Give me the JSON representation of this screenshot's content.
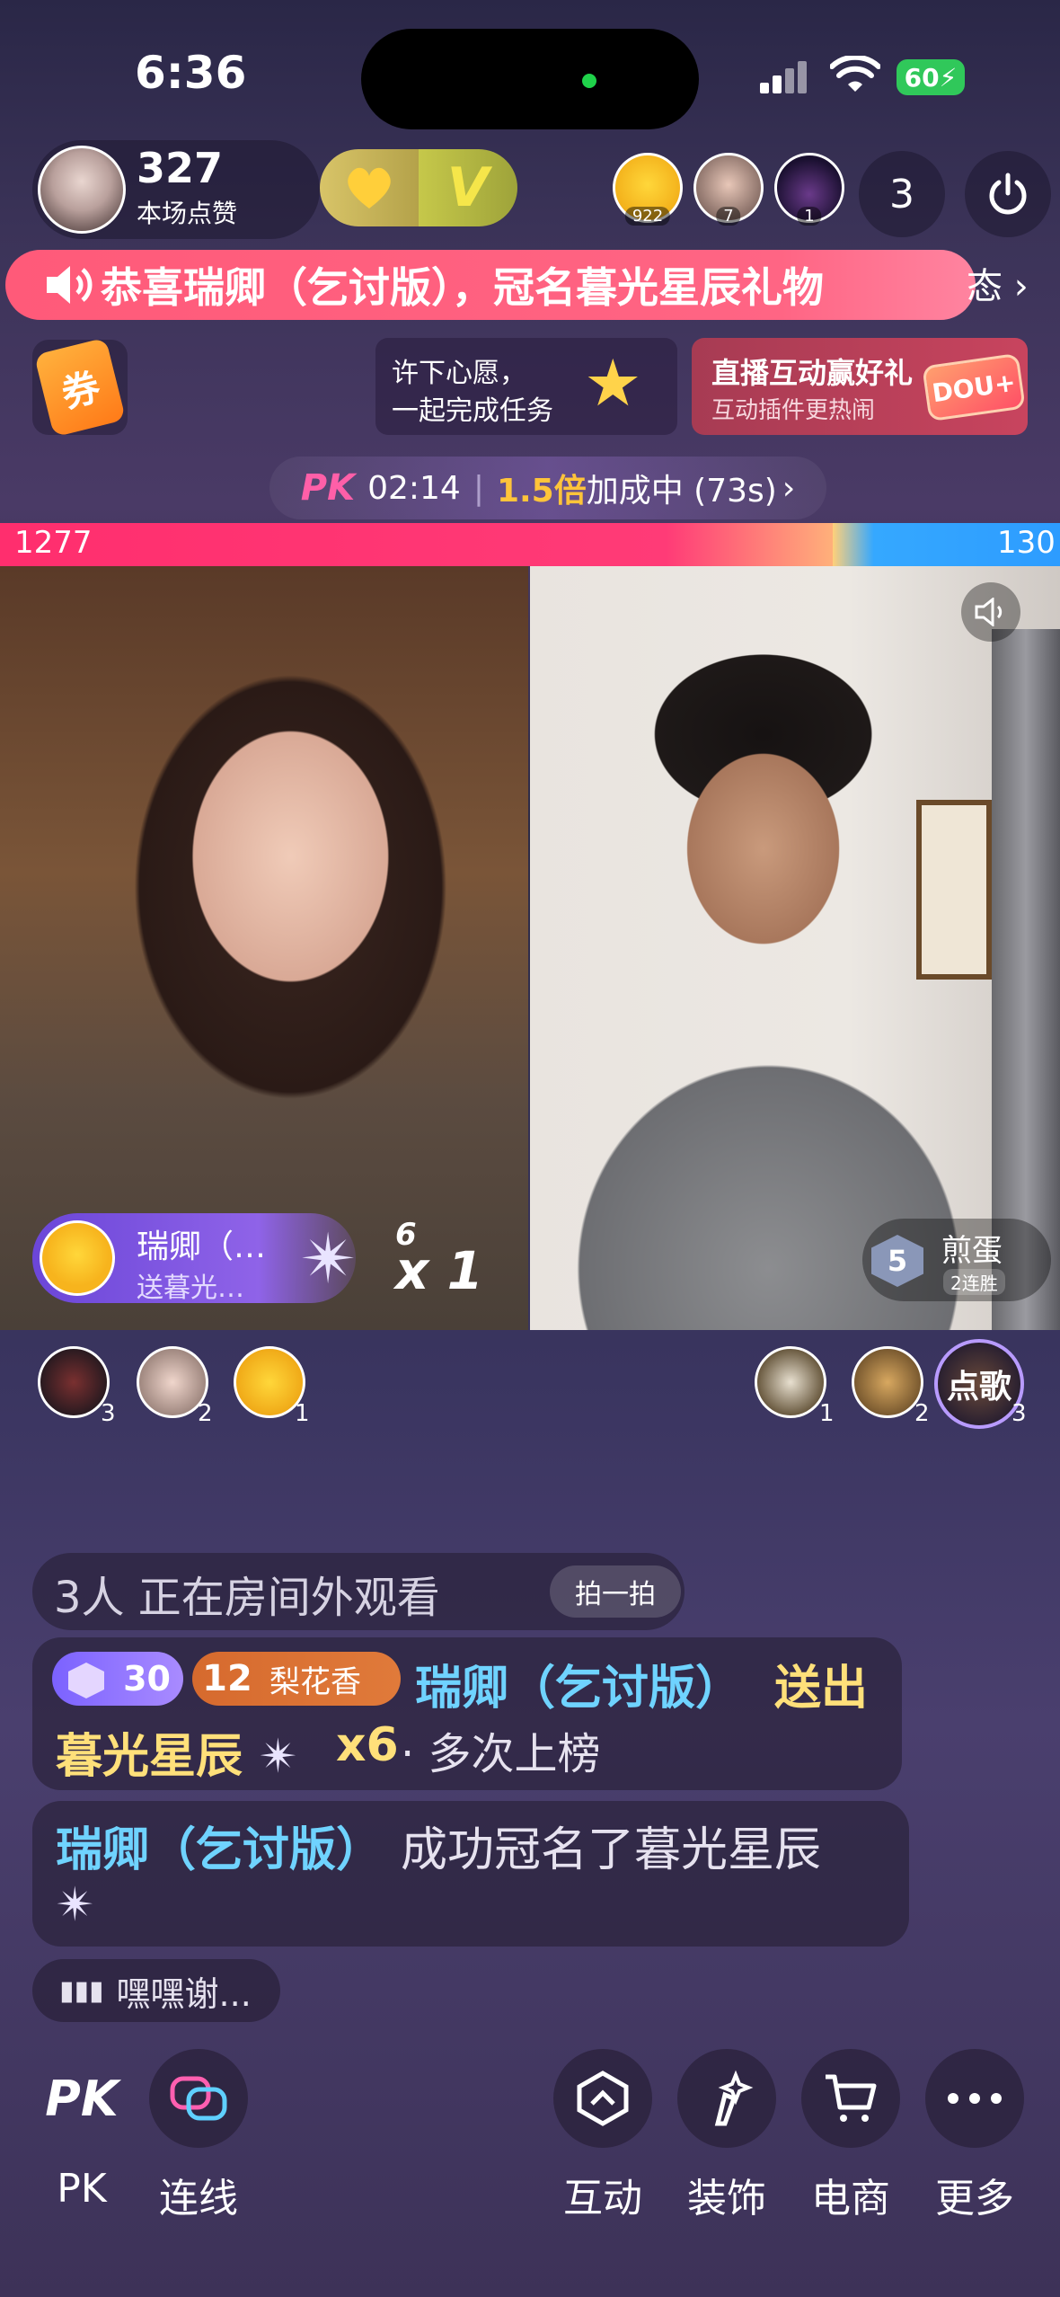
{
  "status": {
    "time": "6:36",
    "battery": "60"
  },
  "host": {
    "likes": "327",
    "likes_label": "本场点赞",
    "badge_v": "V"
  },
  "viewers": [
    {
      "num": "922"
    },
    {
      "num": "7"
    },
    {
      "num": "1"
    }
  ],
  "viewer_count": "3",
  "banner": {
    "text": "恭喜瑞卿（乞讨版），冠名暮光星辰礼物",
    "tail": "态 ›"
  },
  "promo": {
    "coupon_label": "券",
    "wish_line1": "许下心愿，",
    "wish_line2": "一起完成任务",
    "live_line1": "直播互动赢好礼",
    "live_line2": "互动插件更热闹",
    "dou_tag": "DOU+"
  },
  "pk": {
    "logo": "PK",
    "time": "02:14",
    "sep": "|",
    "multiplier": "1.5倍",
    "status": "加成中 (73s)",
    "arrow": "›"
  },
  "score": {
    "left": "1277",
    "right": "130",
    "left_share": 0.786
  },
  "gift_overlay": {
    "name": "瑞卿（…",
    "sub": "送暮光…",
    "count_top": "6",
    "count": "x 1"
  },
  "opponent": {
    "level": "5",
    "name": "煎蛋",
    "streak": "2连胜"
  },
  "contributors_left": [
    {
      "rank": "3"
    },
    {
      "rank": "2"
    },
    {
      "rank": "1"
    }
  ],
  "contributors_right": [
    {
      "rank": "1"
    },
    {
      "rank": "2"
    },
    {
      "rank": "3"
    }
  ],
  "song_button": "点歌",
  "chat": {
    "watching": "3人 正在房间外观看",
    "pai_label": "拍一拍",
    "level": "30",
    "fan_level": "12",
    "fan_club": "梨花香",
    "msg1_user": "瑞卿（乞讨版）",
    "msg1_action": "送出",
    "msg1_gift": "暮光星辰",
    "msg1_count": "x6",
    "msg1_tail": "· 多次上榜",
    "msg2_user": "瑞卿（乞讨版）",
    "msg2_action": "成功冠名了暮光星辰",
    "voice_preview": "嘿嘿谢..."
  },
  "toolbar": [
    {
      "label": "PK",
      "icon": "pk-icon"
    },
    {
      "label": "连线",
      "icon": "link-icon"
    },
    {
      "label": "互动",
      "icon": "interact-icon"
    },
    {
      "label": "装饰",
      "icon": "decorate-icon"
    },
    {
      "label": "电商",
      "icon": "cart-icon"
    },
    {
      "label": "更多",
      "icon": "more-icon"
    }
  ],
  "colors": {
    "pk_red": "#ff2e6e",
    "pk_blue": "#2d9cff",
    "banner_pink": "#ff5a79",
    "accent_purple": "#8f63e8"
  }
}
